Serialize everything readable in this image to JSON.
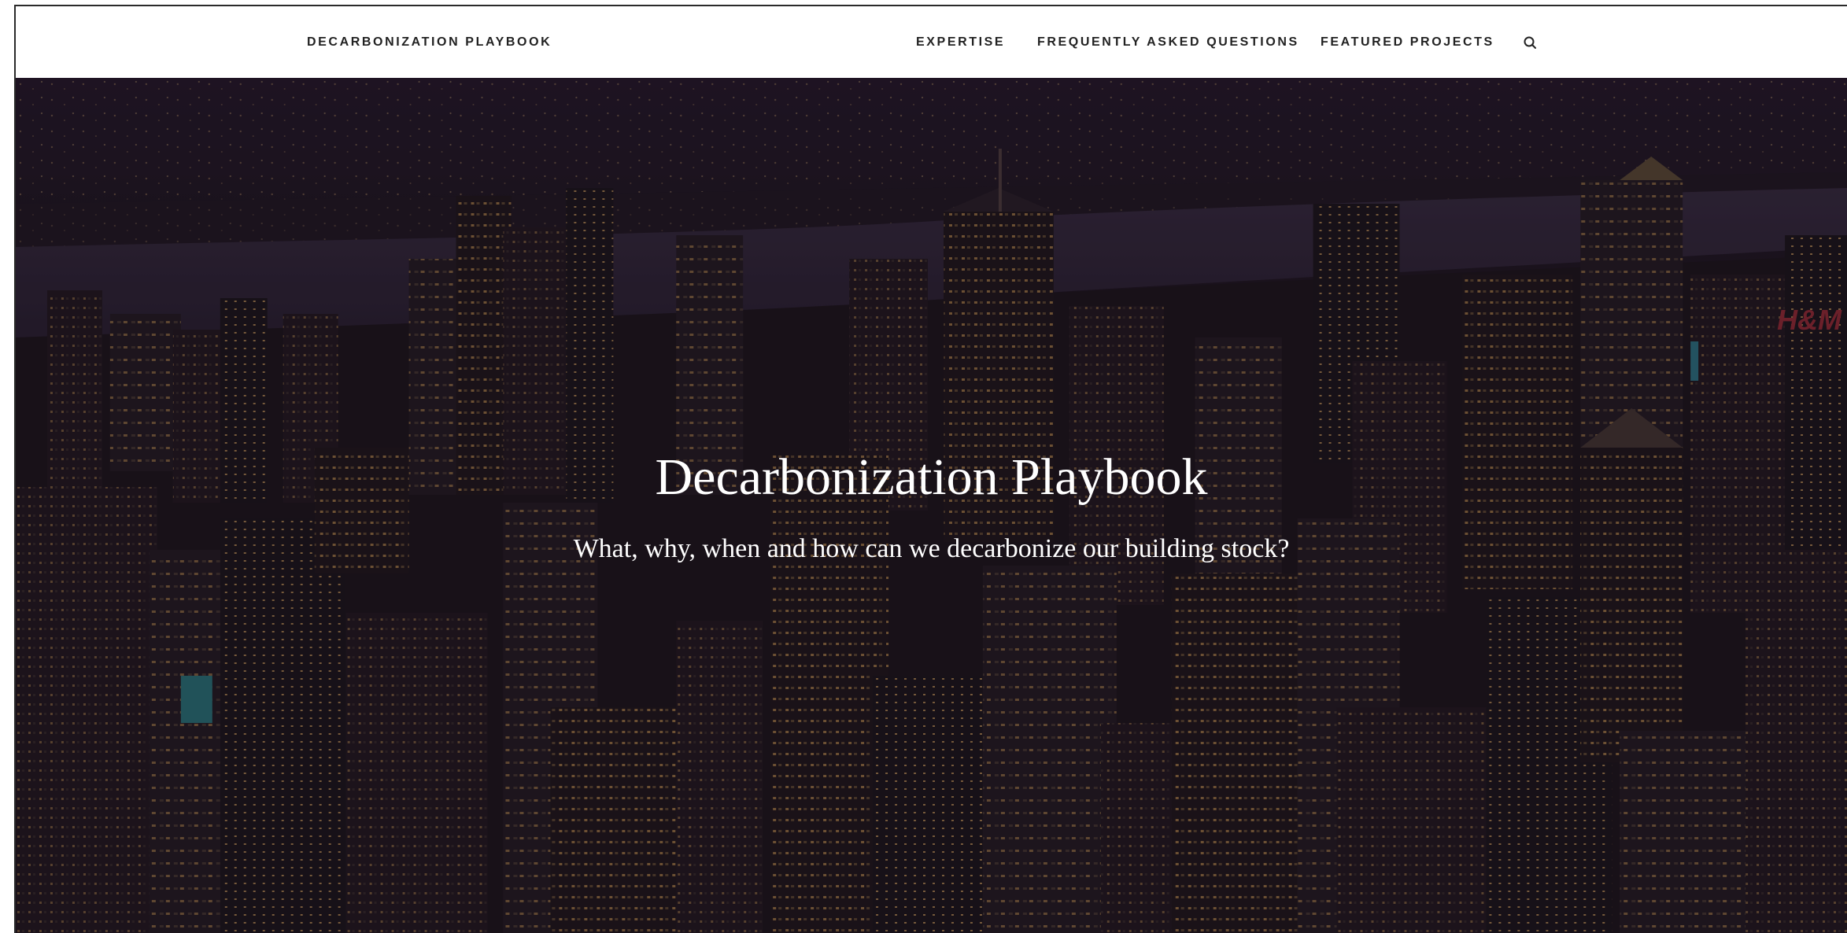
{
  "header": {
    "site_title": "DECARBONIZATION PLAYBOOK",
    "nav": [
      {
        "label": "EXPERTISE"
      },
      {
        "label": "FREQUENTLY ASKED QUESTIONS"
      },
      {
        "label": "FEATURED PROJECTS"
      }
    ],
    "search_icon": "search-icon"
  },
  "hero": {
    "title": "Decarbonization Playbook",
    "subtitle": "What, why, when and how can we decarbonize our building stock?",
    "background_image": "night-city-skyline-image",
    "sign_text": "H&M"
  },
  "colors": {
    "header_bg": "#ffffff",
    "nav_text": "#222222",
    "hero_text": "#ffffff",
    "overlay": "#1c0e22"
  }
}
